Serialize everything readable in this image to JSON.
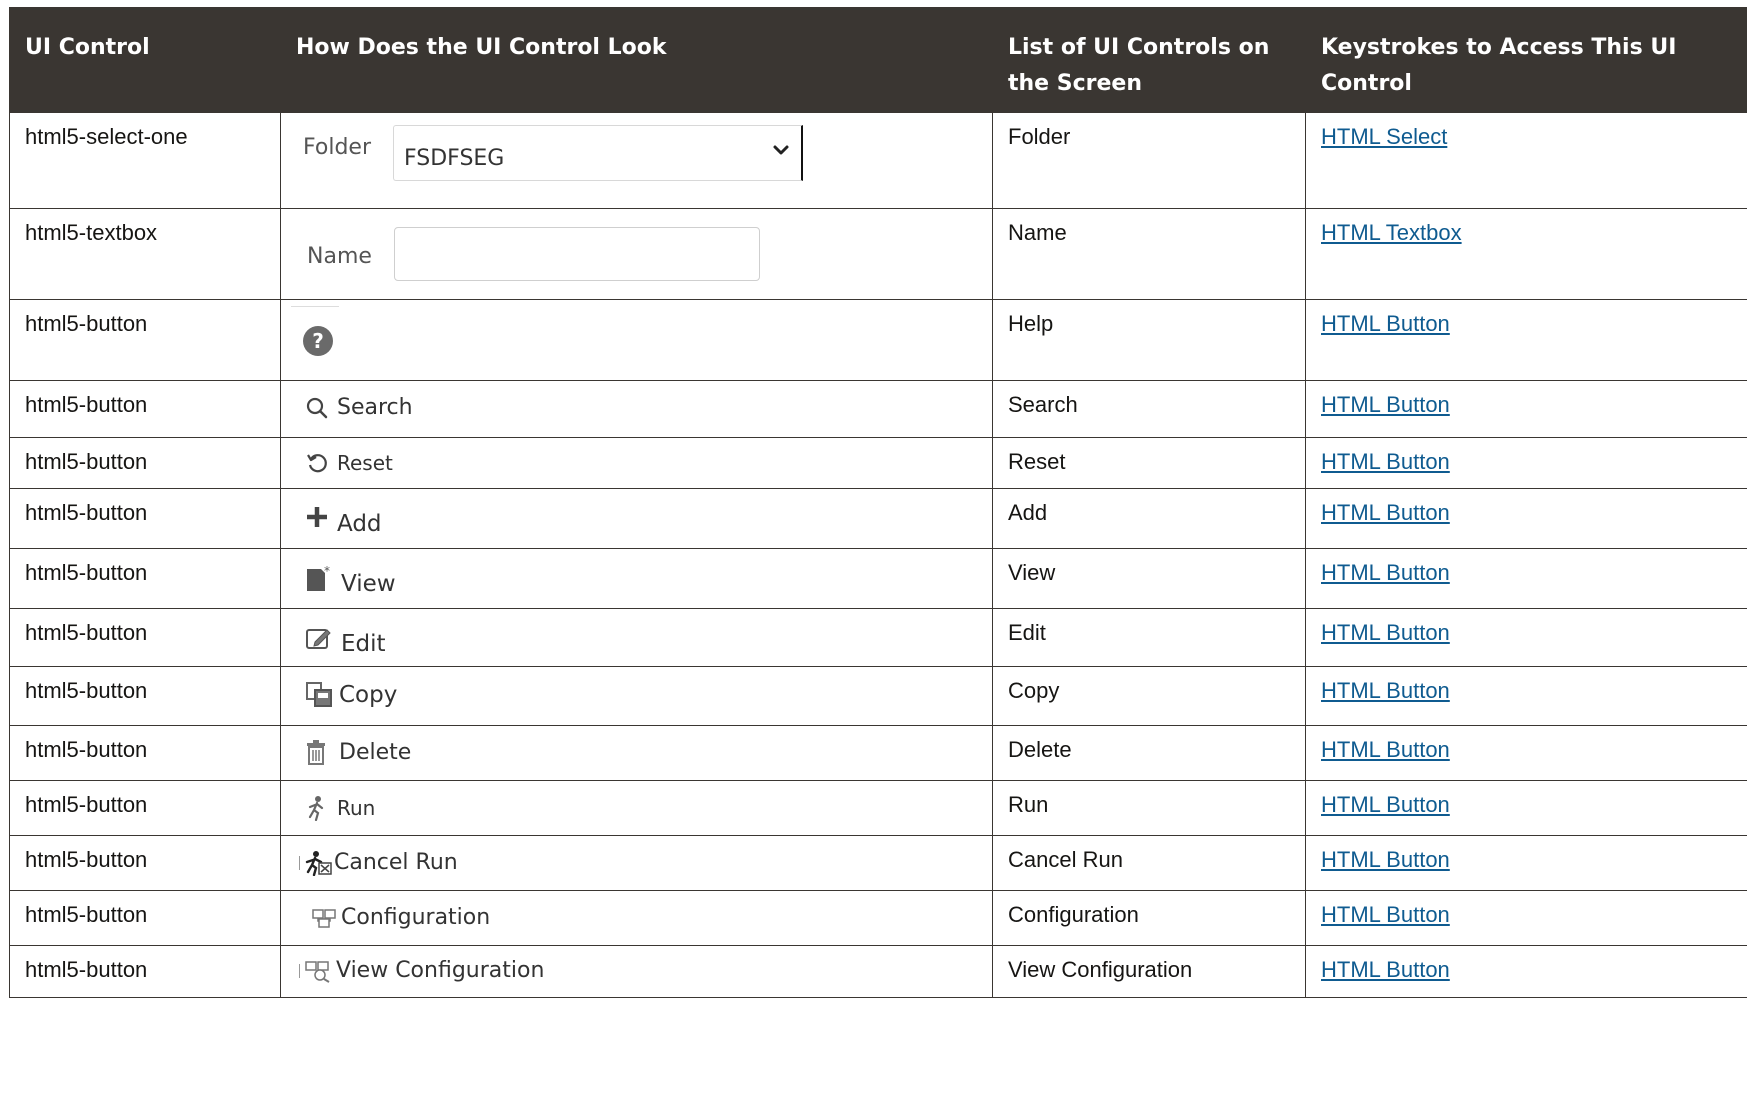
{
  "table": {
    "headers": {
      "ui_control": "UI Control",
      "look": "How Does the UI Control Look",
      "list": "List of UI Controls on the Screen",
      "keystrokes": "Keystrokes to Access This UI Control"
    },
    "rows": [
      {
        "ui_control": "html5-select-one",
        "preview": {
          "type": "select",
          "label": "Folder",
          "value": "FSDFSEG"
        },
        "list": "Folder",
        "keystrokes": "HTML Select"
      },
      {
        "ui_control": "html5-textbox",
        "preview": {
          "type": "textbox",
          "label": "Name",
          "value": ""
        },
        "list": "Name",
        "keystrokes": "HTML Textbox"
      },
      {
        "ui_control": "html5-button",
        "preview": {
          "type": "button",
          "icon": "help-icon",
          "label": ""
        },
        "list": "Help",
        "keystrokes": "HTML Button"
      },
      {
        "ui_control": "html5-button",
        "preview": {
          "type": "button",
          "icon": "search-icon",
          "label": "Search"
        },
        "list": "Search",
        "keystrokes": "HTML Button"
      },
      {
        "ui_control": "html5-button",
        "preview": {
          "type": "button",
          "icon": "reset-icon",
          "label": "Reset"
        },
        "list": "Reset",
        "keystrokes": "HTML Button"
      },
      {
        "ui_control": "html5-button",
        "preview": {
          "type": "button",
          "icon": "plus-icon",
          "label": "Add"
        },
        "list": "Add",
        "keystrokes": "HTML Button"
      },
      {
        "ui_control": "html5-button",
        "preview": {
          "type": "button",
          "icon": "view-icon",
          "label": "View"
        },
        "list": "View",
        "keystrokes": "HTML Button"
      },
      {
        "ui_control": "html5-button",
        "preview": {
          "type": "button",
          "icon": "edit-icon",
          "label": "Edit"
        },
        "list": "Edit",
        "keystrokes": "HTML Button"
      },
      {
        "ui_control": "html5-button",
        "preview": {
          "type": "button",
          "icon": "copy-icon",
          "label": "Copy"
        },
        "list": "Copy",
        "keystrokes": "HTML Button"
      },
      {
        "ui_control": "html5-button",
        "preview": {
          "type": "button",
          "icon": "trash-icon",
          "label": "Delete"
        },
        "list": "Delete",
        "keystrokes": "HTML Button"
      },
      {
        "ui_control": "html5-button",
        "preview": {
          "type": "button",
          "icon": "run-icon",
          "label": "Run"
        },
        "list": "Run",
        "keystrokes": "HTML Button"
      },
      {
        "ui_control": "html5-button",
        "preview": {
          "type": "button",
          "icon": "cancel-run-icon",
          "label": "Cancel Run"
        },
        "list": "Cancel Run",
        "keystrokes": "HTML Button"
      },
      {
        "ui_control": "html5-button",
        "preview": {
          "type": "button",
          "icon": "configuration-icon",
          "label": "Configuration"
        },
        "list": "Configuration",
        "keystrokes": "HTML Button"
      },
      {
        "ui_control": "html5-button",
        "preview": {
          "type": "button",
          "icon": "view-configuration-icon",
          "label": "View Configuration"
        },
        "list": "View Configuration",
        "keystrokes": "HTML Button"
      }
    ]
  },
  "colors": {
    "header_bg": "#3a3632",
    "header_text": "#ffffff",
    "link": "#0f5b90",
    "border": "#3a3632"
  }
}
